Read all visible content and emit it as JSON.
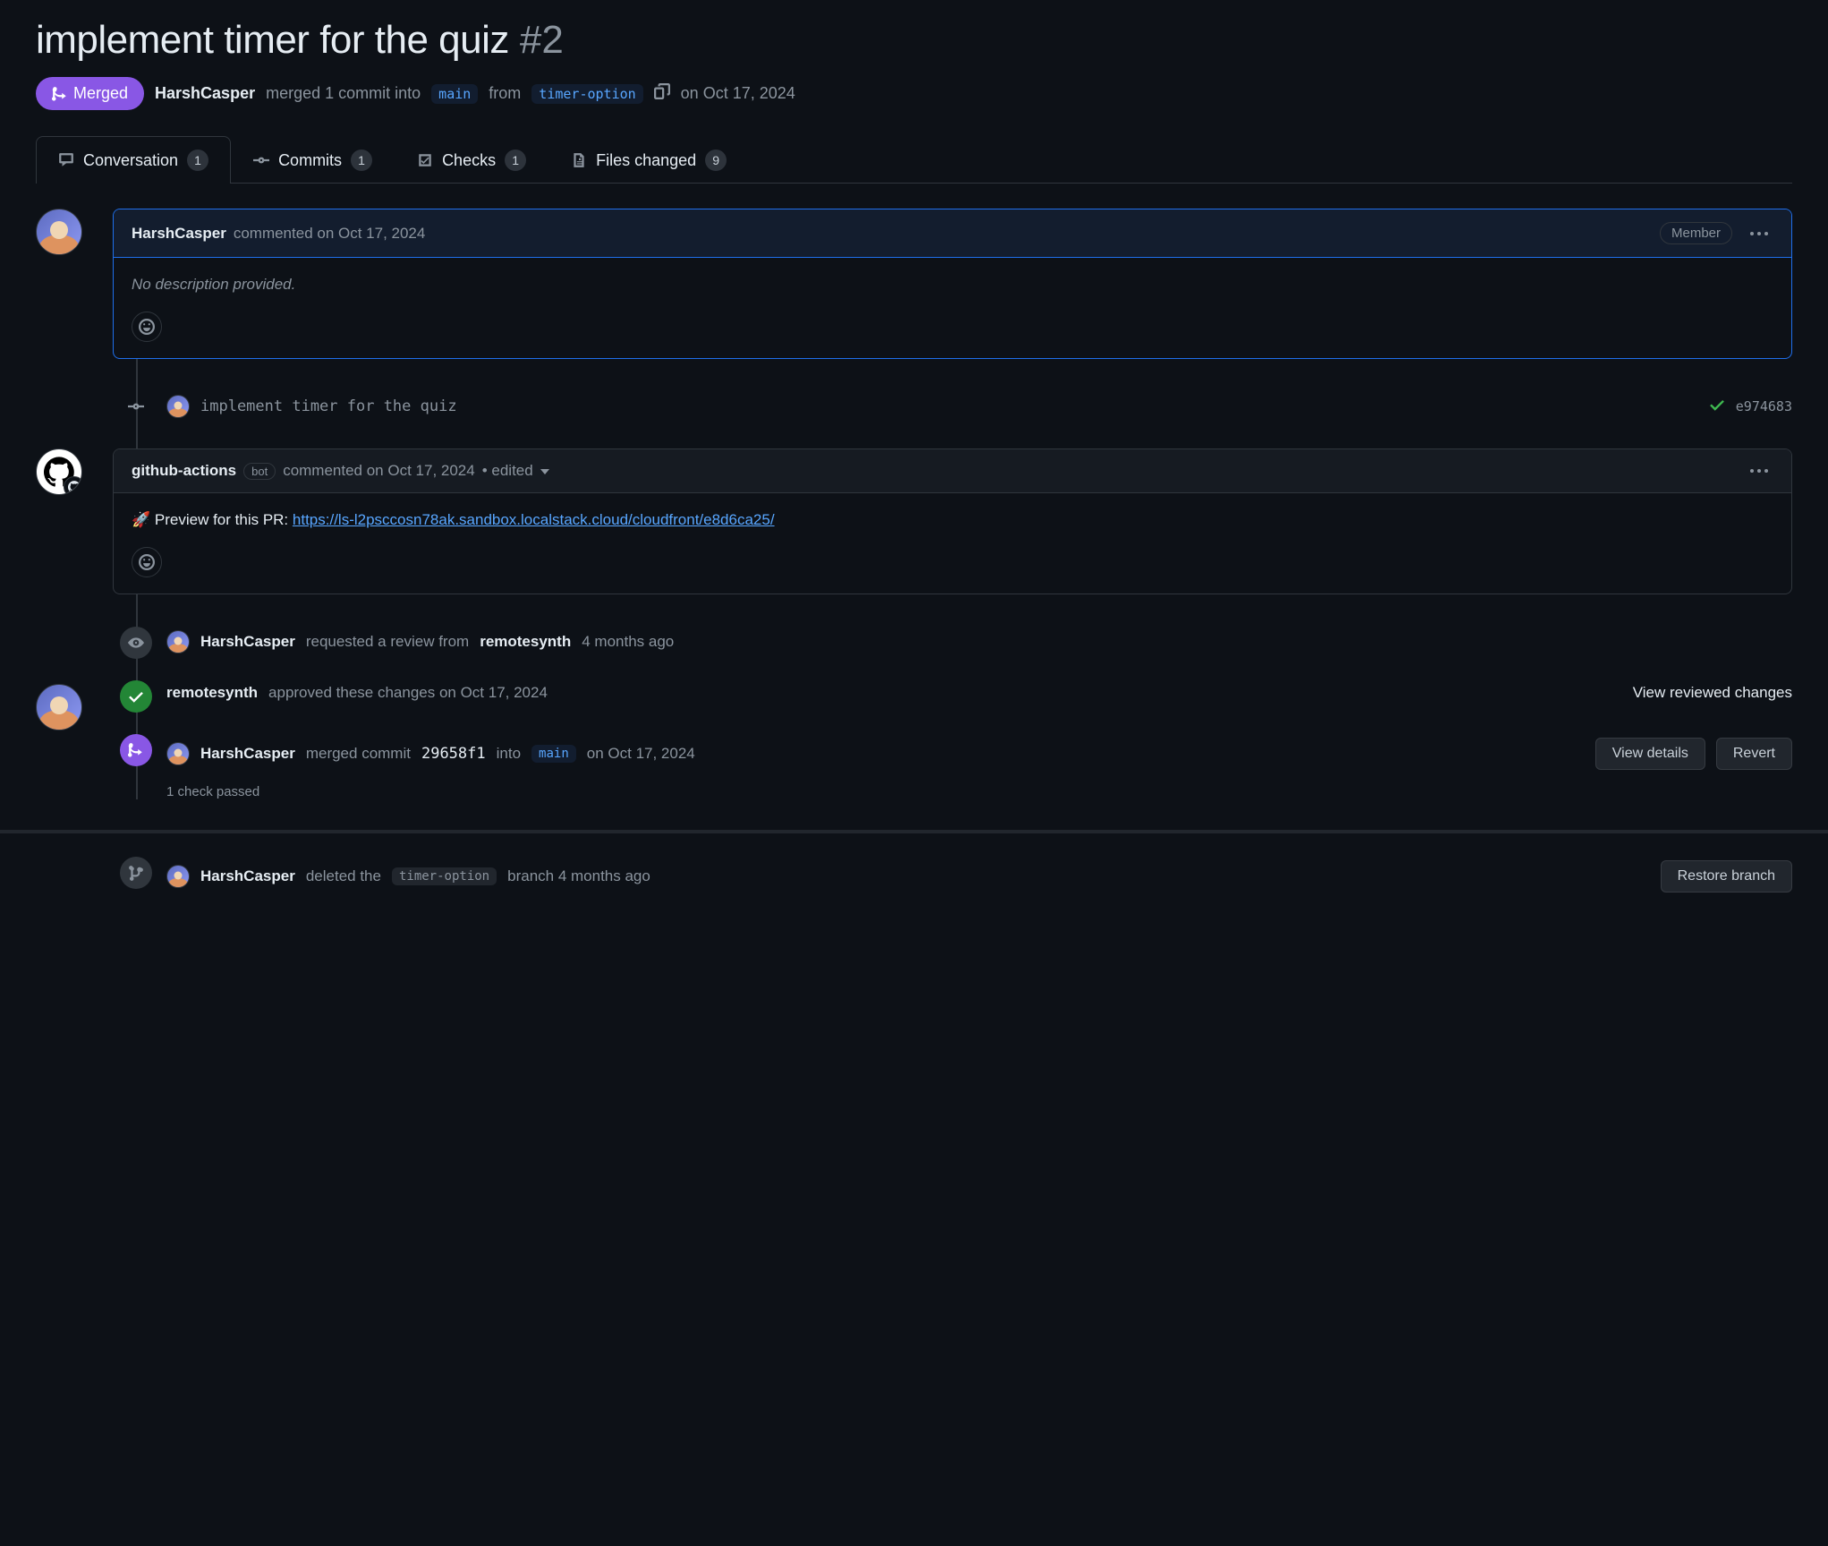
{
  "title": "implement timer for the quiz",
  "pr_number": "#2",
  "status": {
    "label": "Merged",
    "author": "HarshCasper",
    "action": "merged 1 commit into",
    "base_branch": "main",
    "from_word": "from",
    "head_branch": "timer-option",
    "date": "on Oct 17, 2024"
  },
  "tabs": {
    "conversation": {
      "label": "Conversation",
      "count": "1"
    },
    "commits": {
      "label": "Commits",
      "count": "1"
    },
    "checks": {
      "label": "Checks",
      "count": "1"
    },
    "files": {
      "label": "Files changed",
      "count": "9"
    }
  },
  "comment1": {
    "user": "HarshCasper",
    "meta": "commented on Oct 17, 2024",
    "role": "Member",
    "body": "No description provided."
  },
  "commit": {
    "title": "implement timer for the quiz",
    "sha": "e974683"
  },
  "comment2": {
    "user": "github-actions",
    "bot_label": "bot",
    "meta": "commented on Oct 17, 2024",
    "edited": "• edited",
    "body_prefix": "🚀 Preview for this PR: ",
    "body_link": "https://ls-l2psccosn78ak.sandbox.localstack.cloud/cloudfront/e8d6ca25/"
  },
  "review_request": {
    "actor": "HarshCasper",
    "text": "requested a review from",
    "reviewer": "remotesynth",
    "when": "4 months ago"
  },
  "approval": {
    "actor": "remotesynth",
    "text": "approved these changes on Oct 17, 2024",
    "link": "View reviewed changes"
  },
  "merge_event": {
    "actor": "HarshCasper",
    "text1": "merged commit",
    "sha": "29658f1",
    "text2": "into",
    "branch": "main",
    "when": "on Oct 17, 2024",
    "check_note": "1 check passed",
    "btn_details": "View details",
    "btn_revert": "Revert"
  },
  "delete_event": {
    "actor": "HarshCasper",
    "text1": "deleted the",
    "branch": "timer-option",
    "text2": "branch 4 months ago",
    "btn_restore": "Restore branch"
  }
}
